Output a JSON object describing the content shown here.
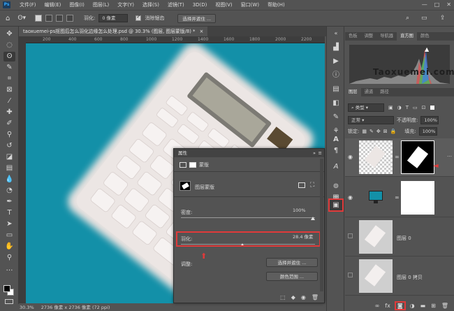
{
  "menubar": {
    "items": [
      "文件(F)",
      "编辑(E)",
      "图像(I)",
      "图层(L)",
      "文字(Y)",
      "选择(S)",
      "滤镜(T)",
      "3D(D)",
      "视图(V)",
      "窗口(W)",
      "帮助(H)"
    ],
    "ps_logo": "Ps",
    "minimize": "—",
    "maximize": "□",
    "close": "✕"
  },
  "options": {
    "feather_label": "羽化:",
    "feather_value": "0 像素",
    "antialias_label": "消除锯齿",
    "select_mask_label": "选择并遮住 ..."
  },
  "document": {
    "tab_title": "taoxuemei-ps抠图后怎么羽化边缘怎么处理.psd @ 30.3% (图层, 图层蒙版/8) *",
    "tab_close": "×"
  },
  "ruler": {
    "labels": [
      "200",
      "400",
      "600",
      "800",
      "1000",
      "1200",
      "1400",
      "1600",
      "1800",
      "2000",
      "2200"
    ]
  },
  "status": {
    "zoom": "30.3%",
    "dimensions": "2736 像素 x 2736 像素 (72 ppi)"
  },
  "properties": {
    "title": "属性",
    "collapse": "»",
    "menu": "≡",
    "tab_mask": "蒙版",
    "layer_mask_label": "图层蒙版",
    "density_label": "密度:",
    "density_value": "100%",
    "feather_label": "羽化:",
    "feather_value": "28.4 像素",
    "refine_label": "调整:",
    "select_mask_button": "选择并遮住 ...",
    "color_range_button": "颜色范围 ..."
  },
  "panel_top_tabs": [
    "色板",
    "调整",
    "导航器",
    "直方图",
    "颜色"
  ],
  "panel_top_active": "直方图",
  "watermark": "Taoxuemei.com",
  "layers_panel": {
    "tabs": [
      "图层",
      "通道",
      "路径"
    ],
    "active_tab": "图层",
    "filter_kind": "类型",
    "blend_mode": "正常",
    "opacity_label": "不透明度:",
    "opacity_value": "100%",
    "lock_label": "锁定:",
    "fill_label": "填充:",
    "fill_value": "100%",
    "layers": [
      {
        "name": "",
        "has_mask": true
      },
      {
        "name": "",
        "has_mask": false
      },
      {
        "name": "图层 0"
      },
      {
        "name": "图层 0 拷贝"
      }
    ],
    "bottom_fx": "fx"
  }
}
